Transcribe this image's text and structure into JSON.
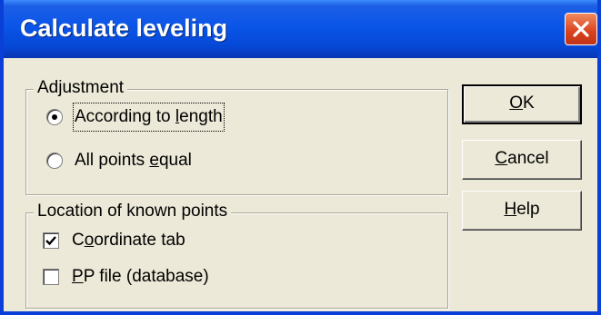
{
  "window": {
    "title": "Calculate leveling"
  },
  "adjustment": {
    "legend": "Adjustment",
    "options": [
      {
        "label_pre": "According to ",
        "label_acc": "l",
        "label_post": "ength",
        "selected": true
      },
      {
        "label_pre": "All points ",
        "label_acc": "e",
        "label_post": "qual",
        "selected": false
      }
    ]
  },
  "known_points": {
    "legend": "Location of known points",
    "options": [
      {
        "label_pre": "C",
        "label_acc": "o",
        "label_post": "ordinate tab",
        "checked": true
      },
      {
        "label_pre": "",
        "label_acc": "P",
        "label_post": "P file (database)",
        "checked": false
      }
    ]
  },
  "buttons": {
    "ok": {
      "acc": "O",
      "rest": "K"
    },
    "cancel": {
      "acc": "C",
      "rest": "ancel"
    },
    "help": {
      "acc": "H",
      "rest": "elp"
    }
  },
  "icons": {
    "close": "close-icon",
    "radio": "radio-button",
    "check": "checkmark-icon"
  }
}
